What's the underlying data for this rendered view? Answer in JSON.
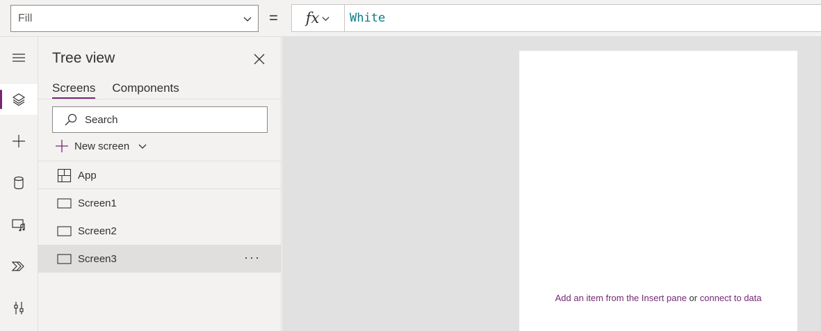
{
  "formula_bar": {
    "property": "Fill",
    "equals": "=",
    "fx": "fx",
    "formula": "White"
  },
  "rail": {
    "items": [
      {
        "icon": "hamburger-icon"
      },
      {
        "icon": "layers-icon",
        "active": true
      },
      {
        "icon": "plus-icon"
      },
      {
        "icon": "database-icon"
      },
      {
        "icon": "media-icon"
      },
      {
        "icon": "power-automate-icon"
      },
      {
        "icon": "tools-icon"
      }
    ]
  },
  "tree_view": {
    "title": "Tree view",
    "tabs": [
      {
        "label": "Screens",
        "active": true
      },
      {
        "label": "Components",
        "active": false
      }
    ],
    "search_placeholder": "Search",
    "new_screen_label": "New screen",
    "items": [
      {
        "label": "App",
        "icon": "app-grid-icon"
      },
      {
        "label": "Screen1",
        "icon": "screen-icon"
      },
      {
        "label": "Screen2",
        "icon": "screen-icon"
      },
      {
        "label": "Screen3",
        "icon": "screen-icon",
        "selected": true,
        "more": "···"
      }
    ]
  },
  "canvas": {
    "hint_link1": "Add an item from the Insert pane",
    "hint_or": " or ",
    "hint_link2": "connect to data"
  },
  "colors": {
    "accent": "#742774",
    "formula_text": "#0a7b83",
    "canvas_bg": "#e1e1e1"
  }
}
